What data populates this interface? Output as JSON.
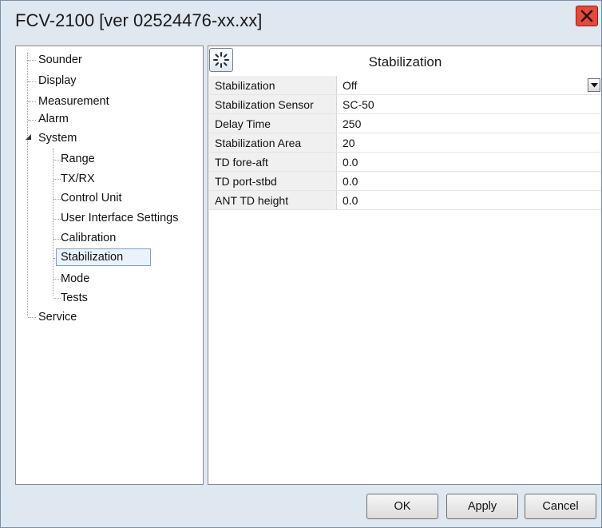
{
  "window": {
    "title": "FCV-2100 [ver 02524476-xx.xx]",
    "close_icon": "close-x-icon",
    "accent_close": "#e34a3e"
  },
  "tree": {
    "items": [
      {
        "label": "Sounder"
      },
      {
        "label": "Display"
      },
      {
        "label": "Measurement"
      },
      {
        "label": "Alarm"
      },
      {
        "label": "System",
        "expanded": true
      },
      {
        "label": "Range"
      },
      {
        "label": "TX/RX"
      },
      {
        "label": "Control Unit"
      },
      {
        "label": "User Interface Settings"
      },
      {
        "label": "Calibration"
      },
      {
        "label": "Stabilization",
        "selected": true
      },
      {
        "label": "Mode"
      },
      {
        "label": "Tests"
      },
      {
        "label": "Service"
      }
    ]
  },
  "panel": {
    "title": "Stabilization",
    "icon": "sparkle-icon"
  },
  "properties": [
    {
      "name": "Stabilization",
      "value": "Off",
      "dropdown": true
    },
    {
      "name": "Stabilization Sensor",
      "value": "SC-50"
    },
    {
      "name": "Delay Time",
      "value": "250"
    },
    {
      "name": "Stabilization Area",
      "value": "20"
    },
    {
      "name": "TD fore-aft",
      "value": "0.0"
    },
    {
      "name": "TD port-stbd",
      "value": "0.0"
    },
    {
      "name": "ANT TD height",
      "value": "0.0"
    }
  ],
  "buttons": {
    "ok": "OK",
    "apply": "Apply",
    "cancel": "Cancel"
  }
}
